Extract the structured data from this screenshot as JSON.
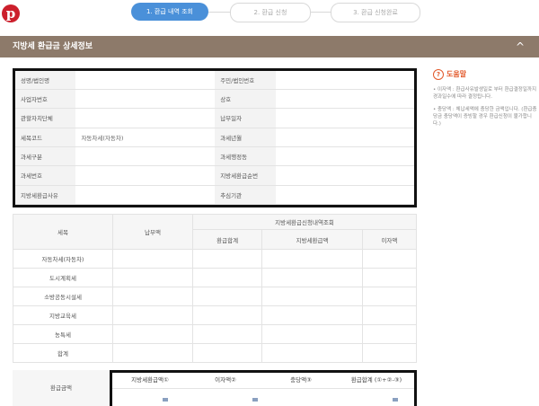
{
  "logo": {
    "letter": "p"
  },
  "steps": [
    {
      "label": "1. 환급 내역 조회"
    },
    {
      "label": "2. 환급 신청"
    },
    {
      "label": "3. 환급 신청완료"
    }
  ],
  "section": {
    "title": "지방세 환급금 상세정보",
    "collapse": "^"
  },
  "info_rows": [
    {
      "l1": "성명/법인명",
      "v1": "",
      "l2": "주민/법인번호",
      "v2": ""
    },
    {
      "l1": "사업자번호",
      "v1": "",
      "l2": "상호",
      "v2": ""
    },
    {
      "l1": "관할자치단체",
      "v1": "",
      "l2": "납부일자",
      "v2": ""
    },
    {
      "l1": "세목코드",
      "v1": "자동차세(자동차)",
      "l2": "과세년월",
      "v2": ""
    },
    {
      "l1": "과세구분",
      "v1": "",
      "l2": "과세행정동",
      "v2": ""
    },
    {
      "l1": "과세번호",
      "v1": "",
      "l2": "지방세환급순번",
      "v2": ""
    },
    {
      "l1": "지방세환급사유",
      "v1": "",
      "l2": "추심기관",
      "v2": ""
    }
  ],
  "help": {
    "title": "도움말",
    "items": [
      "• 이자액 : 환급사유발생일로 부터 환급결정일까지 경과일수에 따라 결정됩니다.",
      "• 충당액 : 체납세액에 충당한 금액입니다. (환급충당금 충당액이 증빙할 경우 환급신청이 불가합니다.)"
    ]
  },
  "detail": {
    "col_tax": "세목",
    "col_paid": "납부액",
    "col_group": "지방세환급신청내역조회",
    "sub_cols": [
      "환급합계",
      "지방세환급액",
      "이자액"
    ],
    "rows": [
      "자동차세(자동차)",
      "도시계획세",
      "소방공동시설세",
      "지방교육세",
      "농특세",
      "합계"
    ]
  },
  "summary": {
    "label": "환급금액",
    "cols": [
      "지방세환급액①",
      "이자액②",
      "충당액③",
      "환급합계 (①+②-③)"
    ]
  }
}
